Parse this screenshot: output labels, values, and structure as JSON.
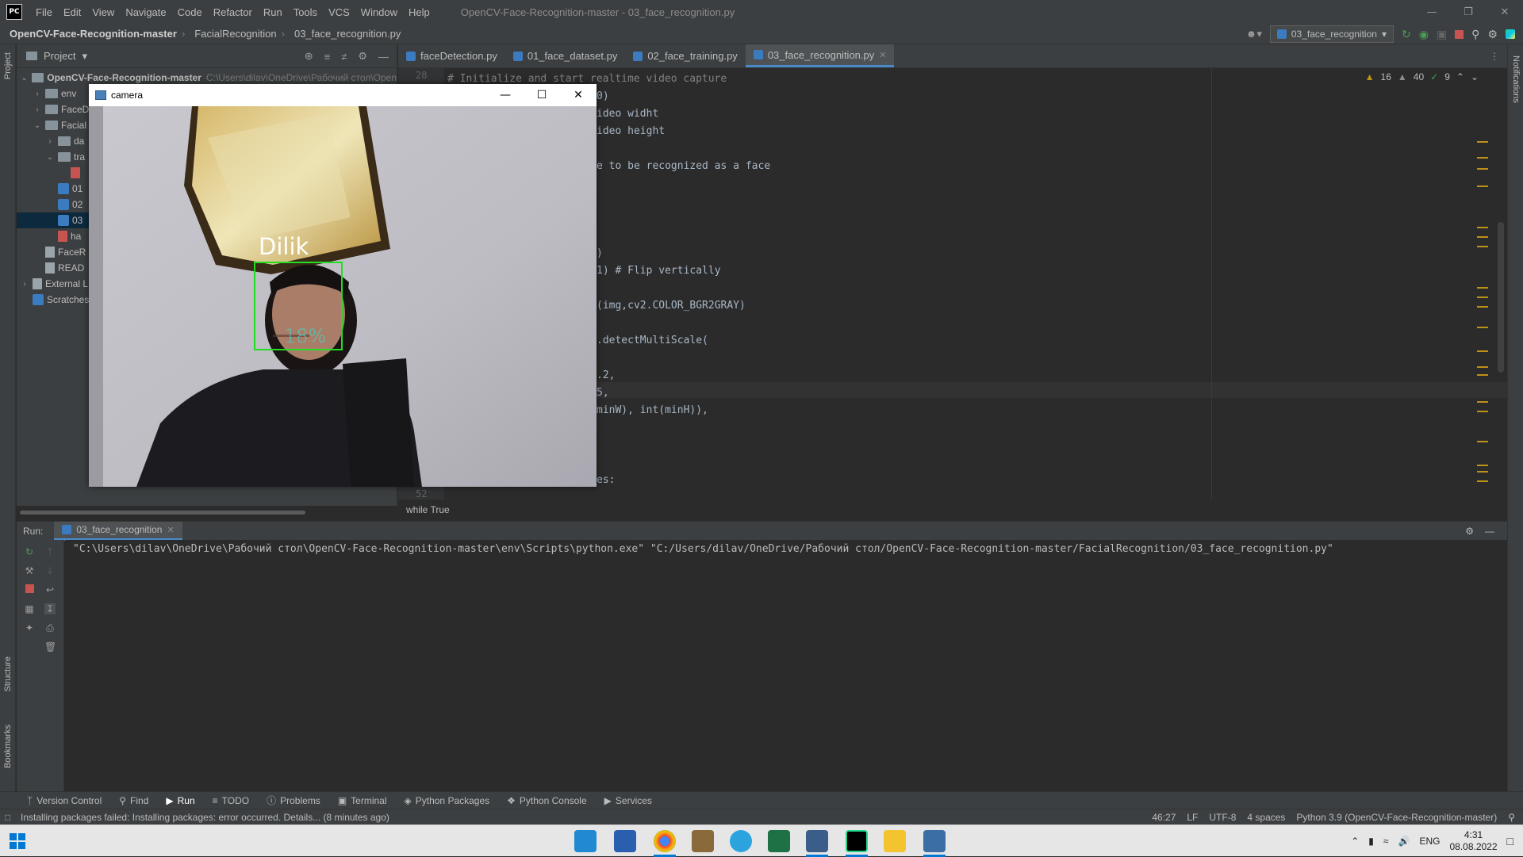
{
  "titlebar": {
    "logo": "PC",
    "menu": [
      "File",
      "Edit",
      "View",
      "Navigate",
      "Code",
      "Refactor",
      "Run",
      "Tools",
      "VCS",
      "Window",
      "Help"
    ],
    "window_title": "OpenCV-Face-Recognition-master - 03_face_recognition.py"
  },
  "navbar": {
    "project": "OpenCV-Face-Recognition-master",
    "folder": "FacialRecognition",
    "file": "03_face_recognition.py",
    "run_config": "03_face_recognition"
  },
  "leftstripe": {
    "project": "Project",
    "structure": "Structure",
    "bookmarks": "Bookmarks"
  },
  "rightstripe": {
    "notifications": "Notifications"
  },
  "project_panel": {
    "title": "Project",
    "tree": [
      {
        "label": "OpenCV-Face-Recognition-master",
        "path": "C:\\Users\\dilav\\OneDrive\\Рабочий стол\\Open",
        "type": "folder",
        "level": 0,
        "open": true
      },
      {
        "label": "env",
        "type": "folder",
        "level": 1
      },
      {
        "label": "FaceD",
        "type": "folder",
        "level": 1
      },
      {
        "label": "Facial",
        "type": "folder",
        "level": 1,
        "open": true
      },
      {
        "label": "da",
        "type": "folder",
        "level": 2
      },
      {
        "label": "tra",
        "type": "folder",
        "level": 2,
        "open": true
      },
      {
        "label": "",
        "type": "xml",
        "level": 3
      },
      {
        "label": "01",
        "type": "py",
        "level": 2
      },
      {
        "label": "02",
        "type": "py",
        "level": 2
      },
      {
        "label": "03",
        "type": "py",
        "level": 2,
        "selected": true
      },
      {
        "label": "ha",
        "type": "xml",
        "level": 2
      },
      {
        "label": "FaceR",
        "type": "txt",
        "level": 1
      },
      {
        "label": "READ",
        "type": "txt",
        "level": 1
      },
      {
        "label": "External L",
        "type": "lib",
        "level": 0
      },
      {
        "label": "Scratches",
        "type": "scratch",
        "level": 0
      }
    ]
  },
  "tabs": [
    {
      "label": "faceDetection.py",
      "active": false
    },
    {
      "label": "01_face_dataset.py",
      "active": false
    },
    {
      "label": "02_face_training.py",
      "active": false
    },
    {
      "label": "03_face_recognition.py",
      "active": true
    }
  ],
  "editor": {
    "inspections": {
      "warnings": "16",
      "weak_warnings": "40",
      "ok": "9"
    },
    "line_numbers": {
      "top": "28",
      "bottom": "52"
    },
    "code": [
      "# Initialize and start realtime video capture",
      "0)",
      "ideo widht",
      "ideo height",
      "",
      "e to be recognized as a face",
      "",
      "",
      "",
      "",
      ")",
      "1) # Flip vertically",
      "",
      "(img,cv2.COLOR_BGR2GRAY)",
      "",
      ".detectMultiScale(",
      "",
      ".2,",
      "5,",
      "minW), int(minH)),",
      "",
      "",
      "",
      "es:"
    ],
    "context": "while True"
  },
  "camera": {
    "title": "camera",
    "label": "Dilik",
    "confidence": "18%",
    "box_color": "#22dd22"
  },
  "run": {
    "label": "Run:",
    "tab": "03_face_recognition",
    "console": "\"C:\\Users\\dilav\\OneDrive\\Рабочий стол\\OpenCV-Face-Recognition-master\\env\\Scripts\\python.exe\" \"C:/Users/dilav/OneDrive/Рабочий стол/OpenCV-Face-Recognition-master/FacialRecognition/03_face_recognition.py\""
  },
  "tooltabs": [
    "Version Control",
    "Find",
    "Run",
    "TODO",
    "Problems",
    "Terminal",
    "Python Packages",
    "Python Console",
    "Services"
  ],
  "statusbar": {
    "message": "Installing packages failed: Installing packages: error occurred. Details... (8 minutes ago)",
    "position": "46:27",
    "line_sep": "LF",
    "encoding": "UTF-8",
    "indent": "4 spaces",
    "interpreter": "Python 3.9 (OpenCV-Face-Recognition-master)"
  },
  "taskbar": {
    "lang": "ENG",
    "time": "4:31",
    "date": "08.08.2022"
  },
  "colors": {
    "accent": "#4a88c7",
    "editor_bg": "#2b2b2b",
    "panel_bg": "#3c3f41",
    "taskbar_bg": "#e6e6e6"
  }
}
